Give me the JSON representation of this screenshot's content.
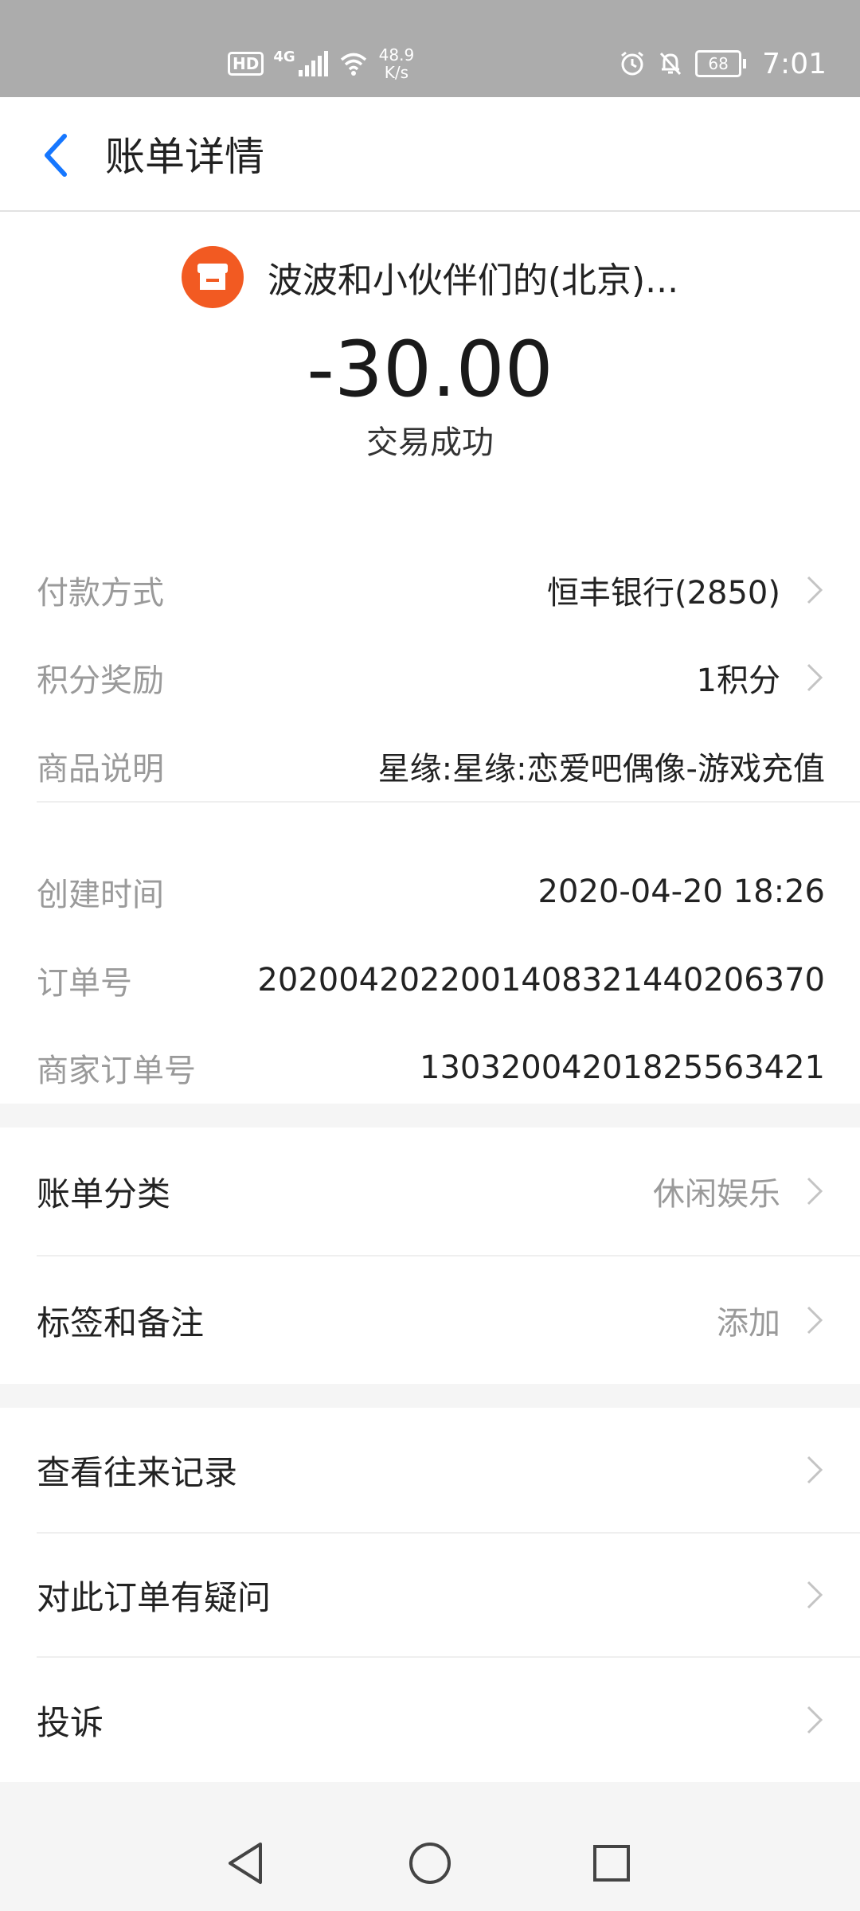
{
  "status_bar": {
    "hd": "HD",
    "network": "4G",
    "speed_value": "48.9",
    "speed_unit": "K/s",
    "battery": "68",
    "time": "7:01"
  },
  "header": {
    "title": "账单详情"
  },
  "summary": {
    "merchant_name": "波波和小伙伴们的(北京)...",
    "amount": "-30.00",
    "status": "交易成功",
    "accent_color": "#f25a22"
  },
  "details": [
    {
      "label": "付款方式",
      "value": "恒丰银行(2850)",
      "has_chevron": true
    },
    {
      "label": "积分奖励",
      "value": "1积分",
      "has_chevron": true
    },
    {
      "label": "商品说明",
      "value": "星缘:星缘:恋爱吧偶像-游戏充值",
      "has_chevron": false
    }
  ],
  "order_info": [
    {
      "label": "创建时间",
      "value": "2020-04-20 18:26"
    },
    {
      "label": "订单号",
      "value": "2020042022001408321440206370"
    },
    {
      "label": "商家订单号",
      "value": "13032004201825563421"
    }
  ],
  "category_section": [
    {
      "label": "账单分类",
      "value": "休闲娱乐"
    },
    {
      "label": "标签和备注",
      "value": "添加"
    }
  ],
  "actions_section": [
    {
      "label": "查看往来记录"
    },
    {
      "label": "对此订单有疑问"
    },
    {
      "label": "投诉"
    }
  ],
  "nav": {
    "back": "back-triangle-icon",
    "home": "home-circle-icon",
    "recents": "recents-square-icon"
  }
}
